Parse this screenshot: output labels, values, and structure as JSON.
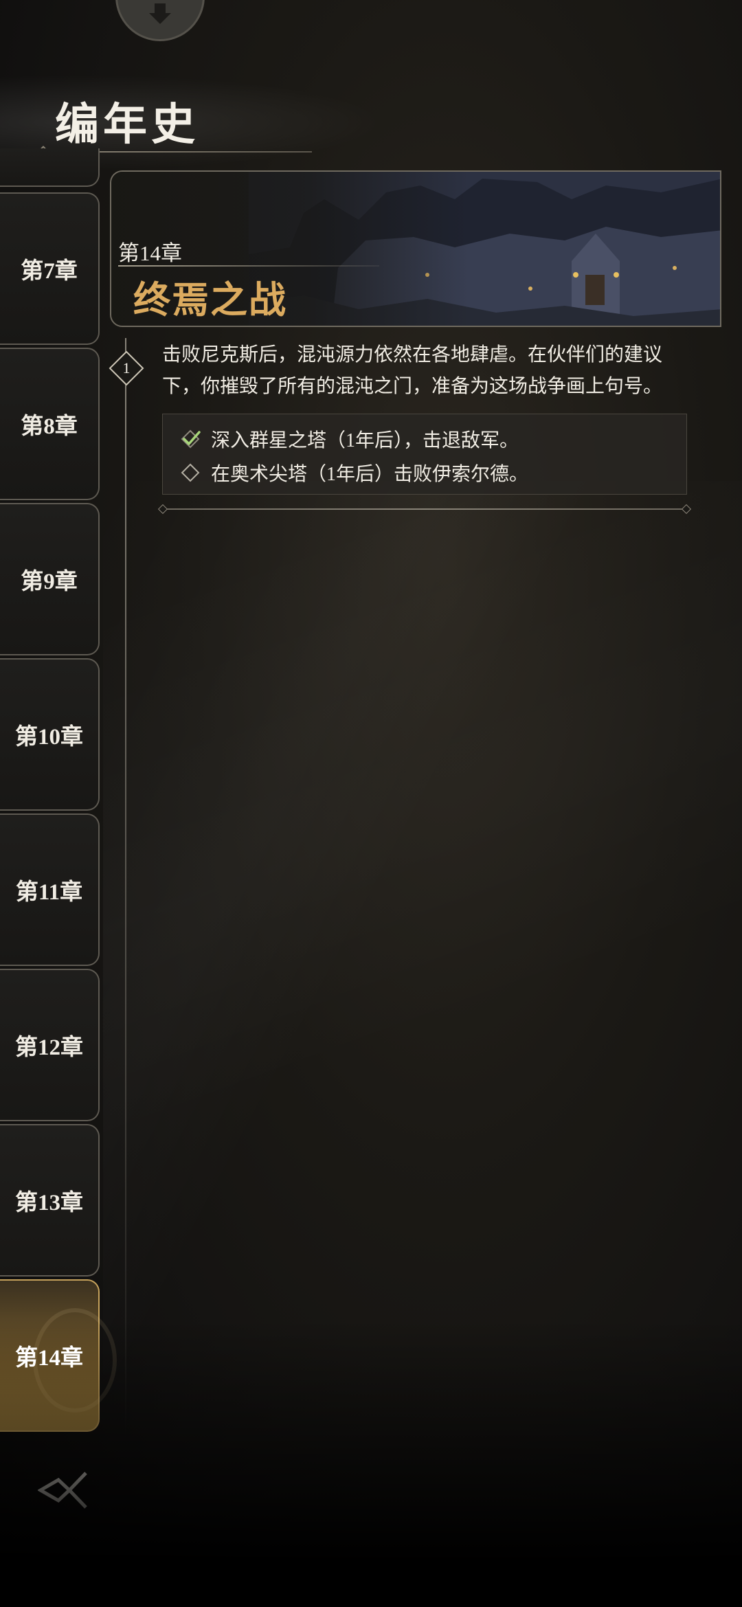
{
  "header": {
    "title": "编年史"
  },
  "sidebar": {
    "chapters": [
      {
        "label": "",
        "active": false
      },
      {
        "label": "第7章",
        "active": false
      },
      {
        "label": "第8章",
        "active": false
      },
      {
        "label": "第9章",
        "active": false
      },
      {
        "label": "第10章",
        "active": false
      },
      {
        "label": "第11章",
        "active": false
      },
      {
        "label": "第12章",
        "active": false
      },
      {
        "label": "第13章",
        "active": false
      },
      {
        "label": "第14章",
        "active": true
      }
    ]
  },
  "chapter": {
    "number_label": "第14章",
    "name": "终焉之战",
    "entries": [
      {
        "index": "1",
        "description": "击败尼克斯后，混沌源力依然在各地肆虐。在伙伴们的建议下，你摧毁了所有的混沌之门，准备为这场战争画上句号。",
        "objectives": [
          {
            "text": "深入群星之塔（1年后），击退敌军。",
            "completed": true,
            "icon": "check-diamond-icon"
          },
          {
            "text": "在奥术尖塔（1年后）击败伊索尔德。",
            "completed": false,
            "icon": "empty-diamond-icon"
          }
        ]
      }
    ]
  },
  "colors": {
    "accent_gold": "#dcab5f",
    "active_tab": "#a3823e",
    "check_green": "#a8d67a"
  }
}
